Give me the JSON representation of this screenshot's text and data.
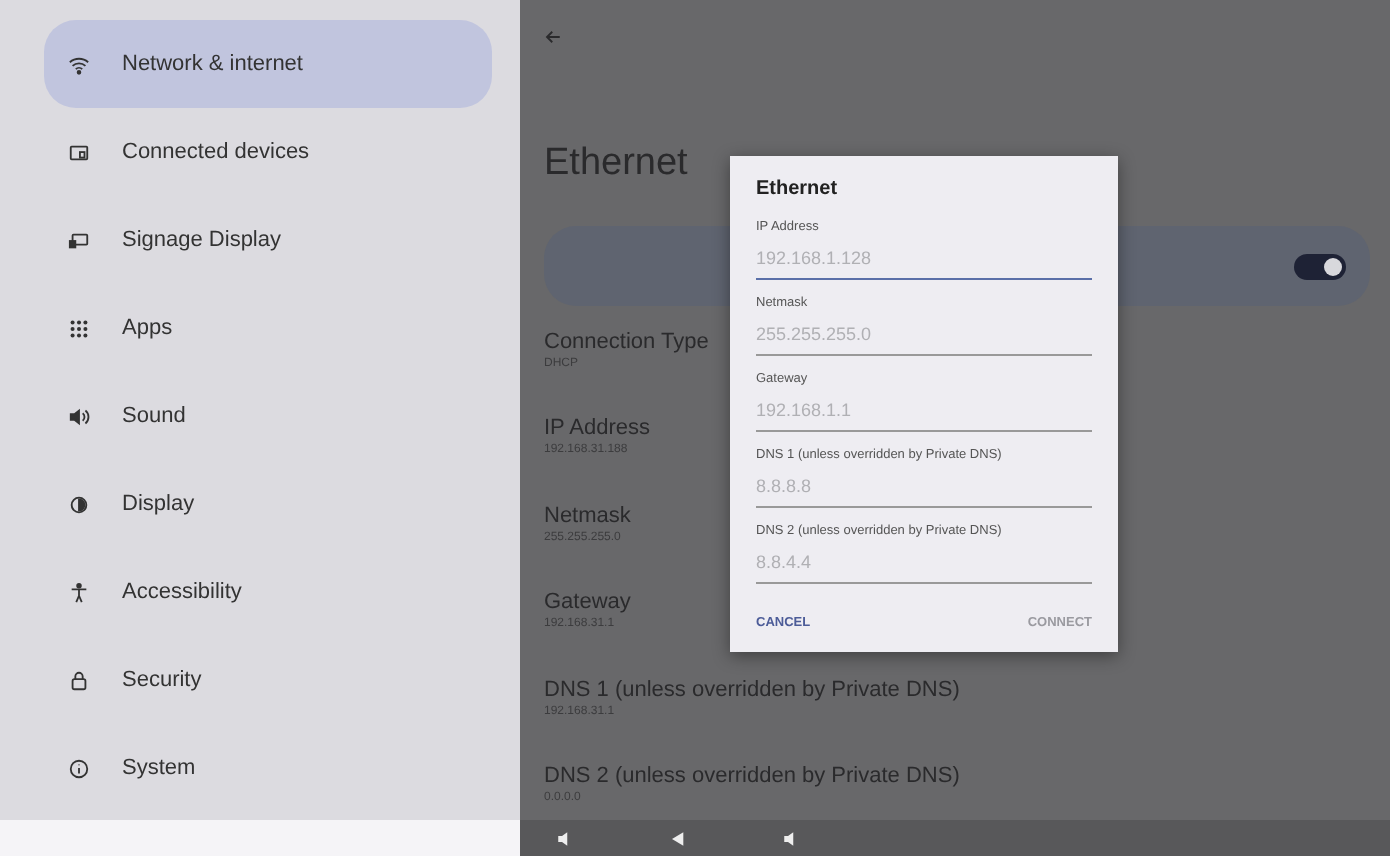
{
  "sidebar": {
    "items": [
      {
        "label": "Network & internet",
        "selected": true
      },
      {
        "label": "Connected devices",
        "selected": false
      },
      {
        "label": "Signage Display",
        "selected": false
      },
      {
        "label": "Apps",
        "selected": false
      },
      {
        "label": "Sound",
        "selected": false
      },
      {
        "label": "Display",
        "selected": false
      },
      {
        "label": "Accessibility",
        "selected": false
      },
      {
        "label": "Security",
        "selected": false
      },
      {
        "label": "System",
        "selected": false
      }
    ]
  },
  "page": {
    "title": "Ethernet",
    "toggle": {
      "on": true
    },
    "details": [
      {
        "title": "Connection Type",
        "value": "DHCP"
      },
      {
        "title": "IP Address",
        "value": "192.168.31.188"
      },
      {
        "title": "Netmask",
        "value": "255.255.255.0"
      },
      {
        "title": "Gateway",
        "value": "192.168.31.1"
      },
      {
        "title": "DNS 1 (unless overridden by Private DNS)",
        "value": "192.168.31.1"
      },
      {
        "title": "DNS 2 (unless overridden by Private DNS)",
        "value": "0.0.0.0"
      }
    ]
  },
  "dialog": {
    "title": "Ethernet",
    "fields": [
      {
        "label": "IP Address",
        "placeholder": "192.168.1.128",
        "focused": true
      },
      {
        "label": "Netmask",
        "placeholder": "255.255.255.0",
        "focused": false
      },
      {
        "label": "Gateway",
        "placeholder": "192.168.1.1",
        "focused": false
      },
      {
        "label": "DNS 1 (unless overridden by Private DNS)",
        "placeholder": "8.8.8.8",
        "focused": false
      },
      {
        "label": "DNS 2 (unless overridden by Private DNS)",
        "placeholder": "8.8.4.4",
        "focused": false
      }
    ],
    "buttons": [
      {
        "label": "CANCEL",
        "disabled": false
      },
      {
        "label": "CONNECT",
        "disabled": true
      }
    ]
  }
}
